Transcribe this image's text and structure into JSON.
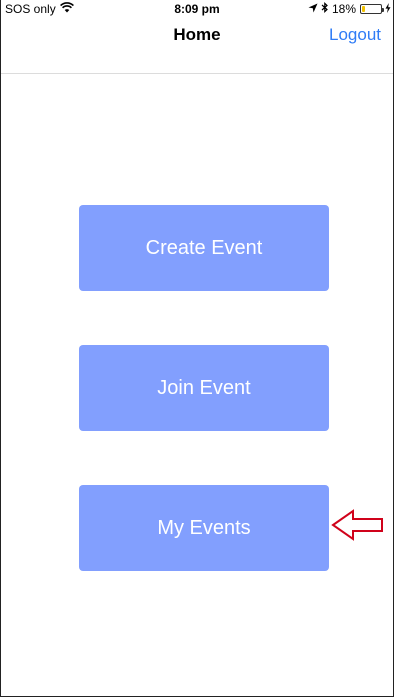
{
  "status_bar": {
    "carrier": "SOS only",
    "time": "8:09 pm",
    "battery": "18%",
    "battery_level": 0.18,
    "battery_fill_color": "#f2c200"
  },
  "nav": {
    "title": "Home",
    "logout_label": "Logout",
    "accent_color": "#2f7cf6"
  },
  "buttons": {
    "create_event": "Create Event",
    "join_event": "Join Event",
    "my_events": "My Events",
    "color": "#829ffe"
  },
  "annotation": {
    "arrow_color": "#d0021b",
    "icon": "left-arrow-outline-icon"
  },
  "icons": {
    "wifi": "wifi-icon",
    "location": "location-arrow-icon",
    "bluetooth": "bluetooth-icon",
    "battery": "battery-icon",
    "charging": "charging-bolt-icon"
  }
}
